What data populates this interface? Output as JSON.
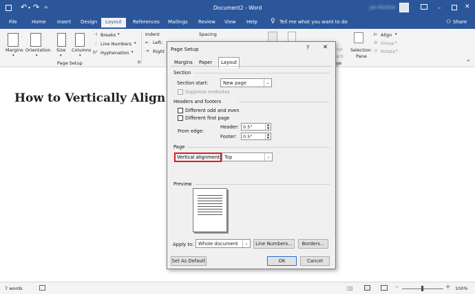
{
  "titlebar": {
    "document_title": "Document2 - Word",
    "user": "Jan Richter",
    "qat": {
      "save": "save-icon",
      "undo": "undo-icon",
      "redo": "redo-icon"
    }
  },
  "tabs": [
    "File",
    "Home",
    "Insert",
    "Design",
    "Layout",
    "References",
    "Mailings",
    "Review",
    "View",
    "Help"
  ],
  "active_tab": "Layout",
  "tell_me": "Tell me what you want to do",
  "share": "Share",
  "ribbon": {
    "margins": "Margins",
    "orientation": "Orientation",
    "size": "Size",
    "columns": "Columns",
    "breaks": "Breaks",
    "line_numbers": "Line Numbers",
    "hyphenation": "Hyphenation",
    "page_setup_group": "Page Setup",
    "indent": "Indent",
    "indent_left": "Left:",
    "indent_right": "Right",
    "spacing": "Spacing",
    "selection_pane_1": "Selection",
    "selection_pane_2": "Pane",
    "align": "Align",
    "group": "Group",
    "rotate": "Rotate",
    "partial_1": "nd",
    "partial_2": "ard",
    "partial_3": "ge"
  },
  "document": {
    "heading": "How to Vertically Align"
  },
  "status": {
    "words": "7 words",
    "zoom": "100%"
  },
  "dialog": {
    "title": "Page Setup",
    "help": "?",
    "close": "✕",
    "tabs": [
      "Margins",
      "Paper",
      "Layout"
    ],
    "active_tab": "Layout",
    "section_header": "Section",
    "section_start_label": "Section start:",
    "section_start_value": "New page",
    "suppress_endnotes": "Suppress endnotes",
    "hf_header": "Headers and footers",
    "different_odd_even": "Different odd and even",
    "different_first_page": "Different first page",
    "from_edge": "From edge:",
    "header_label": "Header:",
    "header_value": "0.5\"",
    "footer_label": "Footer:",
    "footer_value": "0.5\"",
    "page_header": "Page",
    "vertical_alignment_label": "Vertical alignment:",
    "vertical_alignment_value": "Top",
    "preview_header": "Preview",
    "apply_to_label": "Apply to:",
    "apply_to_value": "Whole document",
    "line_numbers_button": "Line Numbers...",
    "borders_button": "Borders...",
    "set_default_button": "Set As Default",
    "ok_button": "OK",
    "cancel_button": "Cancel"
  },
  "colors": {
    "accent": "#2b579a",
    "highlight_box": "#e0181b"
  }
}
